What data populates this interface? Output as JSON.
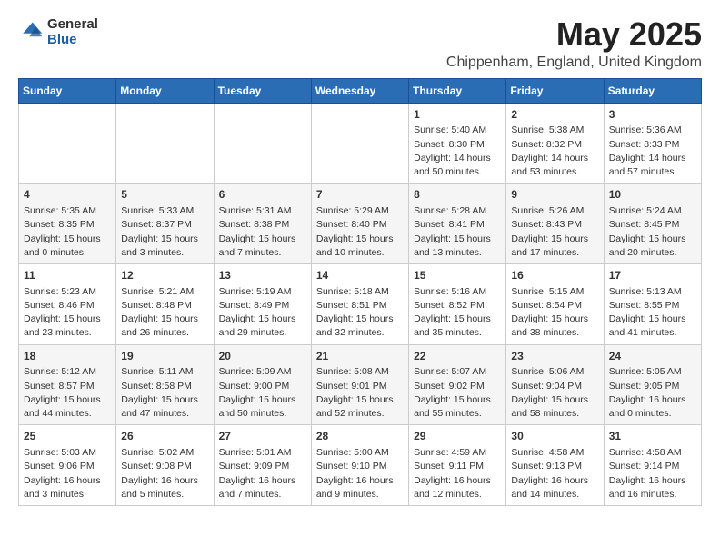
{
  "logo": {
    "general": "General",
    "blue": "Blue"
  },
  "title": "May 2025",
  "subtitle": "Chippenham, England, United Kingdom",
  "days_header": [
    "Sunday",
    "Monday",
    "Tuesday",
    "Wednesday",
    "Thursday",
    "Friday",
    "Saturday"
  ],
  "weeks": [
    [
      {
        "day": "",
        "info": ""
      },
      {
        "day": "",
        "info": ""
      },
      {
        "day": "",
        "info": ""
      },
      {
        "day": "",
        "info": ""
      },
      {
        "day": "1",
        "info": "Sunrise: 5:40 AM\nSunset: 8:30 PM\nDaylight: 14 hours\nand 50 minutes."
      },
      {
        "day": "2",
        "info": "Sunrise: 5:38 AM\nSunset: 8:32 PM\nDaylight: 14 hours\nand 53 minutes."
      },
      {
        "day": "3",
        "info": "Sunrise: 5:36 AM\nSunset: 8:33 PM\nDaylight: 14 hours\nand 57 minutes."
      }
    ],
    [
      {
        "day": "4",
        "info": "Sunrise: 5:35 AM\nSunset: 8:35 PM\nDaylight: 15 hours\nand 0 minutes."
      },
      {
        "day": "5",
        "info": "Sunrise: 5:33 AM\nSunset: 8:37 PM\nDaylight: 15 hours\nand 3 minutes."
      },
      {
        "day": "6",
        "info": "Sunrise: 5:31 AM\nSunset: 8:38 PM\nDaylight: 15 hours\nand 7 minutes."
      },
      {
        "day": "7",
        "info": "Sunrise: 5:29 AM\nSunset: 8:40 PM\nDaylight: 15 hours\nand 10 minutes."
      },
      {
        "day": "8",
        "info": "Sunrise: 5:28 AM\nSunset: 8:41 PM\nDaylight: 15 hours\nand 13 minutes."
      },
      {
        "day": "9",
        "info": "Sunrise: 5:26 AM\nSunset: 8:43 PM\nDaylight: 15 hours\nand 17 minutes."
      },
      {
        "day": "10",
        "info": "Sunrise: 5:24 AM\nSunset: 8:45 PM\nDaylight: 15 hours\nand 20 minutes."
      }
    ],
    [
      {
        "day": "11",
        "info": "Sunrise: 5:23 AM\nSunset: 8:46 PM\nDaylight: 15 hours\nand 23 minutes."
      },
      {
        "day": "12",
        "info": "Sunrise: 5:21 AM\nSunset: 8:48 PM\nDaylight: 15 hours\nand 26 minutes."
      },
      {
        "day": "13",
        "info": "Sunrise: 5:19 AM\nSunset: 8:49 PM\nDaylight: 15 hours\nand 29 minutes."
      },
      {
        "day": "14",
        "info": "Sunrise: 5:18 AM\nSunset: 8:51 PM\nDaylight: 15 hours\nand 32 minutes."
      },
      {
        "day": "15",
        "info": "Sunrise: 5:16 AM\nSunset: 8:52 PM\nDaylight: 15 hours\nand 35 minutes."
      },
      {
        "day": "16",
        "info": "Sunrise: 5:15 AM\nSunset: 8:54 PM\nDaylight: 15 hours\nand 38 minutes."
      },
      {
        "day": "17",
        "info": "Sunrise: 5:13 AM\nSunset: 8:55 PM\nDaylight: 15 hours\nand 41 minutes."
      }
    ],
    [
      {
        "day": "18",
        "info": "Sunrise: 5:12 AM\nSunset: 8:57 PM\nDaylight: 15 hours\nand 44 minutes."
      },
      {
        "day": "19",
        "info": "Sunrise: 5:11 AM\nSunset: 8:58 PM\nDaylight: 15 hours\nand 47 minutes."
      },
      {
        "day": "20",
        "info": "Sunrise: 5:09 AM\nSunset: 9:00 PM\nDaylight: 15 hours\nand 50 minutes."
      },
      {
        "day": "21",
        "info": "Sunrise: 5:08 AM\nSunset: 9:01 PM\nDaylight: 15 hours\nand 52 minutes."
      },
      {
        "day": "22",
        "info": "Sunrise: 5:07 AM\nSunset: 9:02 PM\nDaylight: 15 hours\nand 55 minutes."
      },
      {
        "day": "23",
        "info": "Sunrise: 5:06 AM\nSunset: 9:04 PM\nDaylight: 15 hours\nand 58 minutes."
      },
      {
        "day": "24",
        "info": "Sunrise: 5:05 AM\nSunset: 9:05 PM\nDaylight: 16 hours\nand 0 minutes."
      }
    ],
    [
      {
        "day": "25",
        "info": "Sunrise: 5:03 AM\nSunset: 9:06 PM\nDaylight: 16 hours\nand 3 minutes."
      },
      {
        "day": "26",
        "info": "Sunrise: 5:02 AM\nSunset: 9:08 PM\nDaylight: 16 hours\nand 5 minutes."
      },
      {
        "day": "27",
        "info": "Sunrise: 5:01 AM\nSunset: 9:09 PM\nDaylight: 16 hours\nand 7 minutes."
      },
      {
        "day": "28",
        "info": "Sunrise: 5:00 AM\nSunset: 9:10 PM\nDaylight: 16 hours\nand 9 minutes."
      },
      {
        "day": "29",
        "info": "Sunrise: 4:59 AM\nSunset: 9:11 PM\nDaylight: 16 hours\nand 12 minutes."
      },
      {
        "day": "30",
        "info": "Sunrise: 4:58 AM\nSunset: 9:13 PM\nDaylight: 16 hours\nand 14 minutes."
      },
      {
        "day": "31",
        "info": "Sunrise: 4:58 AM\nSunset: 9:14 PM\nDaylight: 16 hours\nand 16 minutes."
      }
    ]
  ]
}
